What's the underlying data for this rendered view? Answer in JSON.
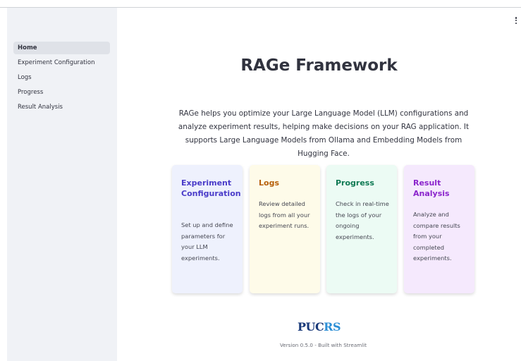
{
  "sidebar": {
    "items": [
      {
        "label": "Home",
        "active": true
      },
      {
        "label": "Experiment Configuration",
        "active": false
      },
      {
        "label": "Logs",
        "active": false
      },
      {
        "label": "Progress",
        "active": false
      },
      {
        "label": "Result Analysis",
        "active": false
      }
    ]
  },
  "header": {
    "menu_icon": "vertical-dots-icon"
  },
  "main": {
    "title": "RAGe Framework",
    "intro": "RAGe helps you optimize your Large Language Model (LLM) configurations and analyze experiment results, helping make decisions on your RAG application. It supports Large Language Models from Ollama and Embedding Models from Hugging Face.",
    "cards": [
      {
        "title": "Experiment Configuration",
        "description": "Set up and define parameters for your LLM experiments.",
        "bg": "#eef1fd",
        "accent": "#4a3cc9"
      },
      {
        "title": "Logs",
        "description": "Review detailed logs from all your experiment runs.",
        "bg": "#fefbe9",
        "accent": "#b7600b"
      },
      {
        "title": "Progress",
        "description": "Check in real-time the logs of your ongoing experiments.",
        "bg": "#ecfbf4",
        "accent": "#107a54"
      },
      {
        "title": "Result Analysis",
        "description": "Analyze and compare results from your completed experiments.",
        "bg": "#f5e9fd",
        "accent": "#8b25cc"
      }
    ]
  },
  "footer": {
    "logo_part1": "PUC",
    "logo_part2": "RS",
    "logo_color1": "#1a3a7a",
    "logo_color2": "#2d8fd6",
    "version_text": "Version 0.5.0 - Built with Streamlit"
  }
}
